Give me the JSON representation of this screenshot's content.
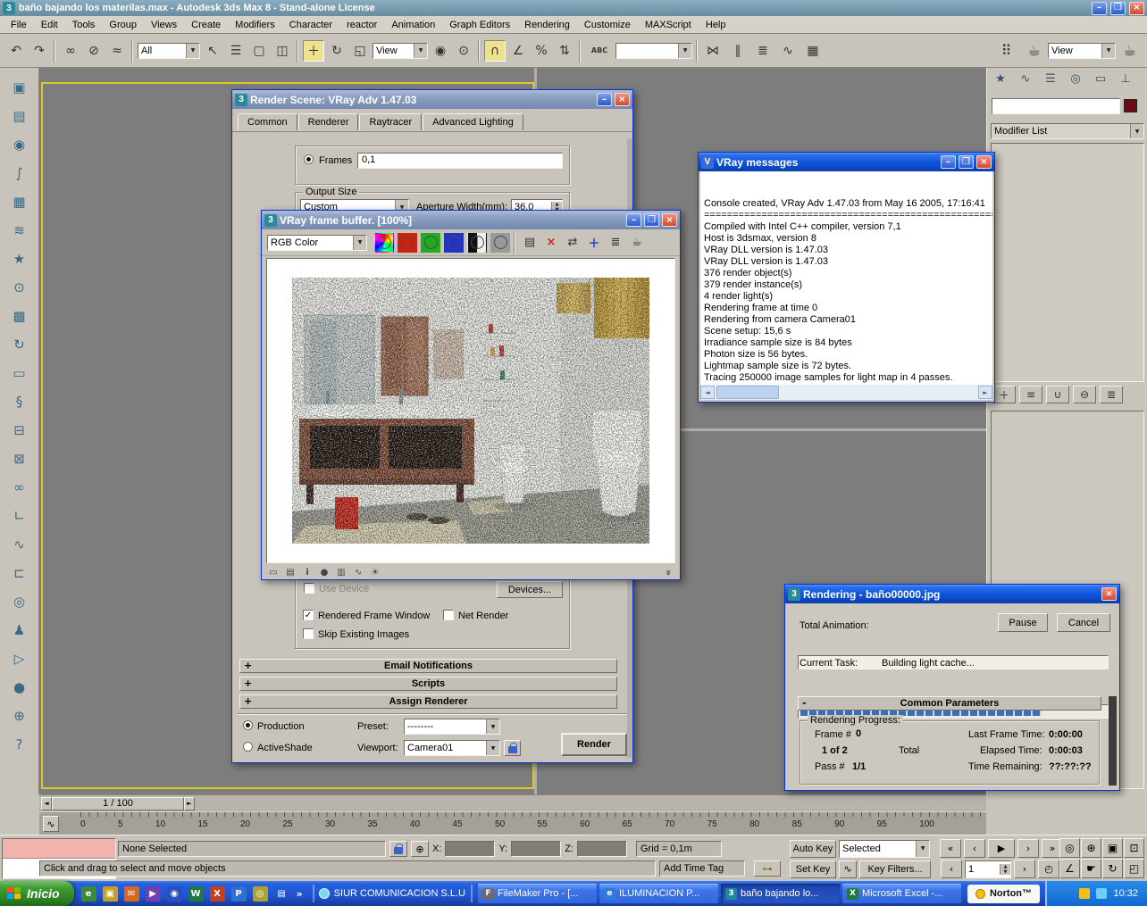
{
  "icons": {
    "chevron_down": "▼",
    "close": "×",
    "minimize": "–",
    "maximize": "❒",
    "check": "✓",
    "plus": "+",
    "minus": "-",
    "left": "◄",
    "right": "►",
    "up": "▲",
    "down": "▼",
    "double_chevron": "»",
    "key": "⊶",
    "curve": "∿",
    "start": "«",
    "prev": "‹",
    "play": "▶",
    "next": "›",
    "end": "»",
    "clock": "◴",
    "mini_curve": "∿"
  },
  "window": {
    "title": "baño bajando los materilas.max - Autodesk 3ds Max 8  - Stand-alone License",
    "logo": "3"
  },
  "menu": [
    "File",
    "Edit",
    "Tools",
    "Group",
    "Views",
    "Create",
    "Modifiers",
    "Character",
    "reactor",
    "Animation",
    "Graph Editors",
    "Rendering",
    "Customize",
    "MAXScript",
    "Help"
  ],
  "toolbar": {
    "filter_all": "All",
    "ref_coord": "View",
    "render_type": "View",
    "named_sets": "",
    "g1": [
      {
        "name": "undo-icon",
        "glyph": "↶"
      },
      {
        "name": "redo-icon",
        "glyph": "↷"
      }
    ],
    "g2": [
      {
        "name": "select-and-link-icon",
        "glyph": "∞"
      },
      {
        "name": "unlink-selection-icon",
        "glyph": "⊘"
      },
      {
        "name": "bind-to-space-warp-icon",
        "glyph": "≈"
      }
    ],
    "g3": [
      {
        "name": "select-object-icon",
        "glyph": "↖"
      },
      {
        "name": "select-by-name-icon",
        "glyph": "☰"
      },
      {
        "name": "rectangular-selection-region-icon",
        "glyph": "▢"
      },
      {
        "name": "window-crossing-toggle-icon",
        "glyph": "◫"
      }
    ],
    "g4": [
      {
        "name": "select-and-move-icon",
        "glyph": "＋",
        "cls": "active"
      },
      {
        "name": "select-and-rotate-icon",
        "glyph": "↻"
      },
      {
        "name": "select-and-uniform-scale-icon",
        "glyph": "◱"
      }
    ],
    "g5": [
      {
        "name": "use-pivot-point-center-icon",
        "glyph": "◉"
      },
      {
        "name": "select-and-manipulate-icon",
        "glyph": "⊙"
      }
    ],
    "g6": [
      {
        "name": "snap-toggle-icon",
        "glyph": "∩",
        "cls": "active"
      },
      {
        "name": "angle-snap-toggle-icon",
        "glyph": "∠"
      },
      {
        "name": "percent-snap-toggle-icon",
        "glyph": "%"
      },
      {
        "name": "spinner-snap-toggle-icon",
        "glyph": "⇅"
      }
    ],
    "g7": [
      {
        "name": "keyboard-shortcut-override-icon",
        "glyph": "ABC"
      }
    ],
    "g8": [
      {
        "name": "mirror-icon",
        "glyph": "⋈"
      },
      {
        "name": "align-icon",
        "glyph": "∥"
      },
      {
        "name": "layer-manager-icon",
        "glyph": "≣"
      },
      {
        "name": "curve-editor-icon",
        "glyph": "∿"
      },
      {
        "name": "schematic-view-icon",
        "glyph": "▦"
      }
    ],
    "g9": [
      {
        "name": "material-editor-icon",
        "glyph": "⠿"
      },
      {
        "name": "render-scene-dialog-icon",
        "glyph": "☕"
      }
    ],
    "g10": [
      {
        "name": "quick-render-icon",
        "glyph": "☕"
      }
    ]
  },
  "left_toolbar": [
    {
      "name": "reactor-rigid-body-collection-icon",
      "glyph": "▣"
    },
    {
      "name": "reactor-cloth-collection-icon",
      "glyph": "▤"
    },
    {
      "name": "reactor-soft-body-collection-icon",
      "glyph": "◉"
    },
    {
      "name": "reactor-rope-collection-icon",
      "glyph": "∫"
    },
    {
      "name": "reactor-deforming-mesh-collection-icon",
      "glyph": "▦"
    },
    {
      "name": "reactor-water-icon",
      "glyph": "≋"
    },
    {
      "name": "reactor-wind-icon",
      "glyph": "★"
    },
    {
      "name": "reactor-toy-car-icon",
      "glyph": "⊙"
    },
    {
      "name": "reactor-fracture-icon",
      "glyph": "▩"
    },
    {
      "name": "reactor-motor-icon",
      "glyph": "↻"
    },
    {
      "name": "reactor-plane-icon",
      "glyph": "▭"
    },
    {
      "name": "reactor-spring-icon",
      "glyph": "§"
    },
    {
      "name": "reactor-linear-dashpot-icon",
      "glyph": "⊟"
    },
    {
      "name": "reactor-angular-dashpot-icon",
      "glyph": "⊠"
    },
    {
      "name": "reactor-point-point-constraint-icon",
      "glyph": "∞"
    },
    {
      "name": "reactor-hinge-constraint-icon",
      "glyph": "∟"
    },
    {
      "name": "reactor-point-path-constraint-icon",
      "glyph": "∿"
    },
    {
      "name": "reactor-prismatic-constraint-icon",
      "glyph": "⊏"
    },
    {
      "name": "reactor-car-wheel-constraint-icon",
      "glyph": "◎"
    },
    {
      "name": "reactor-ragdoll-constraint-icon",
      "glyph": "♟"
    },
    {
      "name": "reactor-preview-animation-icon",
      "glyph": "▷"
    },
    {
      "name": "reactor-create-animation-icon",
      "glyph": "●"
    },
    {
      "name": "reactor-utilities-icon",
      "glyph": "⊕"
    },
    {
      "name": "reactor-analyze-world-icon",
      "glyph": "?"
    }
  ],
  "panel": {
    "tabs": [
      {
        "name": "tab-create-icon",
        "glyph": "★"
      },
      {
        "name": "tab-modify-icon",
        "glyph": "∿"
      },
      {
        "name": "tab-hierarchy-icon",
        "glyph": "☰"
      },
      {
        "name": "tab-motion-icon",
        "glyph": "◎"
      },
      {
        "name": "tab-display-icon",
        "glyph": "▭"
      },
      {
        "name": "tab-utilities-icon",
        "glyph": "⊥"
      }
    ],
    "object_name": "",
    "modifier_list": "Modifier List",
    "stack_tools": [
      {
        "name": "pin-stack-icon",
        "glyph": "＋"
      },
      {
        "name": "show-end-result-icon",
        "glyph": "≡"
      },
      {
        "name": "make-unique-icon",
        "glyph": "∪"
      },
      {
        "name": "remove-modifier-icon",
        "glyph": "⊖"
      },
      {
        "name": "configure-modifier-sets-icon",
        "glyph": "≣"
      }
    ]
  },
  "render_scene": {
    "title": "Render Scene: VRay Adv 1.47.03",
    "tabs": [
      "Common",
      "Renderer",
      "Raytracer",
      "Advanced Lighting"
    ],
    "frames_label": "Frames",
    "frames_value": "0,1",
    "output_size": "Output Size",
    "size_preset": "Custom",
    "aperture_label": "Aperture Width(mm):",
    "aperture_value": "36,0",
    "use_device": "Use Device",
    "devices": "Devices...",
    "rendered_frame_window": "Rendered Frame Window",
    "net_render": "Net Render",
    "skip_existing": "Skip Existing Images",
    "rollout_email": "Email Notifications",
    "rollout_scripts": "Scripts",
    "rollout_assign": "Assign Renderer",
    "production": "Production",
    "activeshade": "ActiveShade",
    "preset_label": "Preset:",
    "preset_value": "--------",
    "viewport_label": "Viewport:",
    "viewport_value": "Camera01",
    "render": "Render"
  },
  "vfb": {
    "title": "VRay frame buffer. [100%]",
    "channel": "RGB Color",
    "channels": [
      {
        "name": "show-rgb-channel-icon",
        "cls": "c-rgb"
      },
      {
        "name": "show-red-channel-icon",
        "cls": "c-red"
      },
      {
        "name": "show-green-channel-icon",
        "cls": "c-green"
      },
      {
        "name": "show-blue-channel-icon",
        "cls": "c-blue"
      },
      {
        "name": "show-alpha-channel-icon",
        "cls": "c-alpha"
      },
      {
        "name": "show-mono-channel-icon",
        "cls": "c-mono"
      }
    ],
    "tools": [
      {
        "name": "save-image-icon",
        "glyph": "▤"
      },
      {
        "name": "clear-image-icon",
        "glyph": "×",
        "cls": "t-red"
      },
      {
        "name": "duplicate-to-host-buffer-icon",
        "glyph": "⇄"
      },
      {
        "name": "track-mouse-icon",
        "glyph": "＋",
        "cls": "t-blue"
      },
      {
        "name": "show-corrections-icon",
        "glyph": "≣"
      },
      {
        "name": "render-last-icon",
        "glyph": "☕"
      }
    ],
    "bottom": [
      {
        "name": "screen-icon",
        "glyph": "▭"
      },
      {
        "name": "image-icon",
        "glyph": "▤"
      },
      {
        "name": "info-icon",
        "glyph": "i",
        "cls": "t-blue"
      },
      {
        "name": "record-icon",
        "glyph": "●",
        "cls": "t-red"
      },
      {
        "name": "histogram-icon",
        "glyph": "▥"
      },
      {
        "name": "curve-icon",
        "glyph": "∿"
      },
      {
        "name": "settings-icon",
        "glyph": "☀"
      }
    ]
  },
  "vray_messages": {
    "title": "VRay messages",
    "lines": [
      "Console created, VRay Adv 1.47.03 from May 16 2005, 17:16:41",
      "============================================================",
      "Compiled with Intel C++ compiler, version 7,1",
      "Host is 3dsmax, version 8",
      "VRay DLL version is 1.47.03",
      "VRay DLL version is 1.47.03",
      "376 render object(s)",
      "379 render instance(s)",
      "4 render light(s)",
      "Rendering frame at time 0",
      "Rendering from camera Camera01",
      "Scene setup: 15,6 s",
      "Irradiance sample size is 84 bytes",
      "Photon size is 56 bytes.",
      "Lightmap sample size is 72 bytes.",
      "Tracing 250000 image samples for light map in 4 passes."
    ]
  },
  "rendering": {
    "title": "Rendering - baño00000.jpg",
    "total_animation": "Total Animation:",
    "pause": "Pause",
    "cancel": "Cancel",
    "current_task_label": "Current Task:",
    "current_task_value": "Building light cache...",
    "progress_width": "width:78%",
    "common_parameters": "Common Parameters",
    "rendering_progress": "Rendering Progress:",
    "frame_label": "Frame #",
    "frame_value": "0",
    "frame_count": "1 of 2",
    "total_label": "Total",
    "last_frame_label": "Last Frame Time:",
    "last_frame_value": "0:00:00",
    "elapsed_label": "Elapsed Time:",
    "elapsed_value": "0:00:03",
    "pass_label": "Pass #",
    "pass_value": "1/1",
    "remaining_label": "Time Remaining:",
    "remaining_value": "??:??:??"
  },
  "timeline": {
    "slider": "1 / 100"
  },
  "ruler": [
    "0",
    "5",
    "10",
    "15",
    "20",
    "25",
    "30",
    "35",
    "40",
    "45",
    "50",
    "55",
    "60",
    "65",
    "70",
    "75",
    "80",
    "85",
    "90",
    "95",
    "100"
  ],
  "status": {
    "selection": "None Selected",
    "x_label": "X:",
    "y_label": "Y:",
    "z_label": "Z:",
    "grid": "Grid = 0,1m",
    "prompt": "Click and drag to select and move objects",
    "add_time_tag": "Add Time Tag",
    "auto_key": "Auto Key",
    "set_key": "Set Key",
    "key_mode": "Selected",
    "key_filters": "Key Filters...",
    "frame_number": "1"
  },
  "nav_cluster": [
    {
      "name": "zoom-icon",
      "glyph": "◎"
    },
    {
      "name": "zoom-all-icon",
      "glyph": "⊕"
    },
    {
      "name": "zoom-extents-icon",
      "glyph": "▣"
    },
    {
      "name": "zoom-region-icon",
      "glyph": "⊡"
    },
    {
      "name": "field-of-view-icon",
      "glyph": "∠"
    },
    {
      "name": "pan-icon",
      "glyph": "☛"
    },
    {
      "name": "arc-rotate-icon",
      "glyph": "↻"
    },
    {
      "name": "min-max-toggle-icon",
      "glyph": "◰"
    }
  ],
  "taskbar": {
    "start": "Inicio",
    "quick_launch": [
      {
        "name": "quick-launch-internet-explorer-icon",
        "glyph": "e"
      },
      {
        "name": "quick-launch-show-desktop-icon",
        "glyph": "▣"
      },
      {
        "name": "quick-launch-outlook-icon",
        "glyph": "✉"
      },
      {
        "name": "quick-launch-media-player-icon",
        "glyph": "▶"
      },
      {
        "name": "quick-launch-msn-messenger-icon",
        "glyph": "◉"
      },
      {
        "name": "quick-launch-word-icon",
        "glyph": "W"
      },
      {
        "name": "quick-launch-excel-icon",
        "glyph": "X"
      },
      {
        "name": "quick-launch-powerpoint-icon",
        "glyph": "P"
      },
      {
        "name": "quick-launch-browser-icon",
        "glyph": "◎"
      },
      {
        "name": "quick-launch-folder-icon",
        "glyph": "▤"
      }
    ],
    "overflow_chevron": "»",
    "band_label": "SIUR COMUNICACION S.L.U",
    "tasks": [
      {
        "label": "FileMaker Pro - [...",
        "icon": "F"
      },
      {
        "label": "ILUMINACION P...",
        "icon": "e"
      },
      {
        "label": "baño bajando lo...",
        "icon": "3"
      },
      {
        "label": "Microsoft Excel -...",
        "icon": "X"
      }
    ],
    "norton": "Norton™",
    "time": "10:32"
  }
}
